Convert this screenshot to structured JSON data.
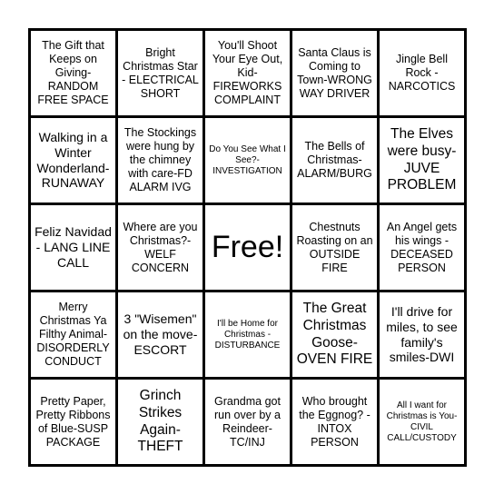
{
  "board": {
    "colors": {
      "border": "#000000",
      "cell_bg": "#ffffff",
      "text": "#000000"
    },
    "cells": [
      [
        "The Gift that Keeps on Giving-RANDOM FREE SPACE",
        "Bright Christmas Star - ELECTRICAL SHORT",
        "You'll Shoot Your Eye Out, Kid-FIREWORKS COMPLAINT",
        "Santa Claus is Coming to Town-WRONG WAY DRIVER",
        "Jingle Bell Rock - NARCOTICS"
      ],
      [
        "Walking in a Winter Wonderland-RUNAWAY",
        "The Stockings were hung by the chimney with care-FD ALARM IVG",
        "Do You See What I See?-INVESTIGATION",
        "The Bells of Christmas-ALARM/BURG",
        "The Elves were busy-JUVE PROBLEM"
      ],
      [
        "Feliz Navidad - LANG LINE CALL",
        "Where are you Christmas?-WELF CONCERN",
        "Free!",
        "Chestnuts Roasting on an OUTSIDE FIRE",
        "An Angel gets his wings - DECEASED PERSON"
      ],
      [
        "Merry Christmas Ya Filthy Animal-DISORDERLY CONDUCT",
        "3 \"Wisemen\" on the move-ESCORT",
        "I'll be Home for Christmas - DISTURBANCE",
        "The Great Christmas Goose-OVEN FIRE",
        "I'll drive for miles, to see family's smiles-DWI"
      ],
      [
        "Pretty Paper, Pretty Ribbons of Blue-SUSP PACKAGE",
        "Grinch Strikes Again-THEFT",
        "Grandma got run over by a Reindeer-TC/INJ",
        "Who brought the Eggnog? -INTOX PERSON",
        "All I want for Christmas is You-CIVIL CALL/CUSTODY"
      ]
    ]
  }
}
